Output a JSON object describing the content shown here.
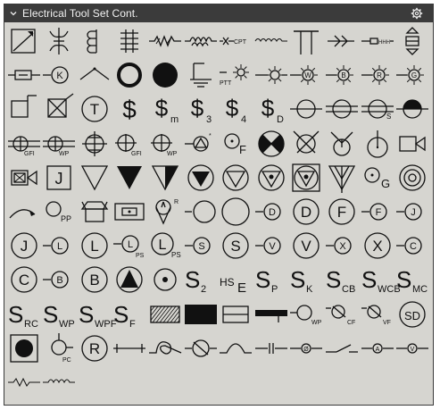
{
  "panel": {
    "title": "Electrical Tool Set Cont.",
    "collapse_icon": "chevron-down-icon",
    "settings_icon": "gear-icon"
  },
  "symbols": [
    {
      "row": 0,
      "col": 0,
      "kind": "box-diagonal"
    },
    {
      "row": 0,
      "col": 1,
      "kind": "transformer-fork"
    },
    {
      "row": 0,
      "col": 2,
      "kind": "coil-e"
    },
    {
      "row": 0,
      "col": 3,
      "kind": "coil-double"
    },
    {
      "row": 0,
      "col": 4,
      "kind": "zigzag-line"
    },
    {
      "row": 0,
      "col": 5,
      "kind": "coil-line"
    },
    {
      "row": 0,
      "col": 6,
      "kind": "cpt-line",
      "text": "CPT"
    },
    {
      "row": 0,
      "col": 7,
      "kind": "wave-line"
    },
    {
      "row": 0,
      "col": 8,
      "kind": "double-t"
    },
    {
      "row": 0,
      "col": 9,
      "kind": "arrows"
    },
    {
      "row": 0,
      "col": 10,
      "kind": "resistor-hhh",
      "text": "HHH"
    },
    {
      "row": 0,
      "col": 11,
      "kind": "updown-box"
    },
    {
      "row": 1,
      "col": 0,
      "kind": "fuse-line"
    },
    {
      "row": 1,
      "col": 1,
      "kind": "circle-letter-line",
      "text": "K"
    },
    {
      "row": 1,
      "col": 2,
      "kind": "switch-arc"
    },
    {
      "row": 1,
      "col": 3,
      "kind": "ring-bold"
    },
    {
      "row": 1,
      "col": 4,
      "kind": "dot-filled"
    },
    {
      "row": 1,
      "col": 5,
      "kind": "ground"
    },
    {
      "row": 1,
      "col": 6,
      "kind": "ptt-star",
      "text": "PTT"
    },
    {
      "row": 1,
      "col": 7,
      "kind": "star-line"
    },
    {
      "row": 1,
      "col": 8,
      "kind": "star-letter",
      "text": "W"
    },
    {
      "row": 1,
      "col": 9,
      "kind": "star-letter",
      "text": "B"
    },
    {
      "row": 1,
      "col": 10,
      "kind": "star-letter",
      "text": "R"
    },
    {
      "row": 1,
      "col": 11,
      "kind": "star-letter",
      "text": "G"
    },
    {
      "row": 2,
      "col": 0,
      "kind": "box-flag"
    },
    {
      "row": 2,
      "col": 1,
      "kind": "box-x-line"
    },
    {
      "row": 2,
      "col": 2,
      "kind": "circle-letter",
      "text": "T"
    },
    {
      "row": 2,
      "col": 3,
      "kind": "dollar",
      "text": "$"
    },
    {
      "row": 2,
      "col": 4,
      "kind": "dollar-sub",
      "text": "$",
      "sub": "m"
    },
    {
      "row": 2,
      "col": 5,
      "kind": "dollar-sub",
      "text": "$",
      "sub": "3"
    },
    {
      "row": 2,
      "col": 6,
      "kind": "dollar-sub",
      "text": "$",
      "sub": "4"
    },
    {
      "row": 2,
      "col": 7,
      "kind": "dollar-sub",
      "text": "$",
      "sub": "D"
    },
    {
      "row": 2,
      "col": 8,
      "kind": "circle-bar"
    },
    {
      "row": 2,
      "col": 9,
      "kind": "circle-double-bar"
    },
    {
      "row": 2,
      "col": 10,
      "kind": "circle-double-bar-sub",
      "text": "S"
    },
    {
      "row": 2,
      "col": 11,
      "kind": "circle-half"
    },
    {
      "row": 3,
      "col": 0,
      "kind": "circle-bars-sub",
      "text": "GFI"
    },
    {
      "row": 3,
      "col": 1,
      "kind": "circle-bars-sub",
      "text": "WP"
    },
    {
      "row": 3,
      "col": 2,
      "kind": "circle-cross"
    },
    {
      "row": 3,
      "col": 3,
      "kind": "circle-cross-sub",
      "text": "GFI"
    },
    {
      "row": 3,
      "col": 4,
      "kind": "circle-cross-sub",
      "text": "WP"
    },
    {
      "row": 3,
      "col": 5,
      "kind": "circle-triangle-star"
    },
    {
      "row": 3,
      "col": 6,
      "kind": "circle-dot-letter",
      "text": "F"
    },
    {
      "row": 3,
      "col": 7,
      "kind": "circle-x-quadrant"
    },
    {
      "row": 3,
      "col": 8,
      "kind": "circle-x-open"
    },
    {
      "row": 3,
      "col": 9,
      "kind": "circle-y"
    },
    {
      "row": 3,
      "col": 10,
      "kind": "circle-stem"
    },
    {
      "row": 3,
      "col": 11,
      "kind": "camera"
    },
    {
      "row": 4,
      "col": 0,
      "kind": "camera-x"
    },
    {
      "row": 4,
      "col": 1,
      "kind": "box-letter",
      "text": "J"
    },
    {
      "row": 4,
      "col": 2,
      "kind": "triangle-open"
    },
    {
      "row": 4,
      "col": 3,
      "kind": "triangle-filled"
    },
    {
      "row": 4,
      "col": 4,
      "kind": "triangle-half"
    },
    {
      "row": 4,
      "col": 5,
      "kind": "circle-tri-filled"
    },
    {
      "row": 4,
      "col": 6,
      "kind": "circle-tri-open"
    },
    {
      "row": 4,
      "col": 7,
      "kind": "circle-tri-dot"
    },
    {
      "row": 4,
      "col": 8,
      "kind": "box-circle-tri"
    },
    {
      "row": 4,
      "col": 9,
      "kind": "tri-stem"
    },
    {
      "row": 4,
      "col": 10,
      "kind": "circle-o-letter",
      "text": "G"
    },
    {
      "row": 4,
      "col": 11,
      "kind": "target"
    },
    {
      "row": 5,
      "col": 0,
      "kind": "arc-arrow"
    },
    {
      "row": 5,
      "col": 1,
      "kind": "circle-sub-small",
      "text": "PP"
    },
    {
      "row": 5,
      "col": 2,
      "kind": "box-tray"
    },
    {
      "row": 5,
      "col": 3,
      "kind": "box-oval"
    },
    {
      "row": 5,
      "col": 4,
      "kind": "antenna",
      "text": "R"
    },
    {
      "row": 5,
      "col": 5,
      "kind": "circle-line-left"
    },
    {
      "row": 5,
      "col": 6,
      "kind": "circle-plain"
    },
    {
      "row": 5,
      "col": 7,
      "kind": "circle-letter-line",
      "text": "D"
    },
    {
      "row": 5,
      "col": 8,
      "kind": "circle-letter",
      "text": "D"
    },
    {
      "row": 5,
      "col": 9,
      "kind": "circle-letter",
      "text": "F"
    },
    {
      "row": 5,
      "col": 10,
      "kind": "circle-letter-line",
      "text": "F"
    },
    {
      "row": 5,
      "col": 11,
      "kind": "circle-letter-line",
      "text": "J"
    },
    {
      "row": 6,
      "col": 0,
      "kind": "circle-letter",
      "text": "J"
    },
    {
      "row": 6,
      "col": 1,
      "kind": "circle-letter-line",
      "text": "L"
    },
    {
      "row": 6,
      "col": 2,
      "kind": "circle-letter",
      "text": "L"
    },
    {
      "row": 6,
      "col": 3,
      "kind": "circle-letter-line-sub",
      "text": "L",
      "sub": "PS"
    },
    {
      "row": 6,
      "col": 4,
      "kind": "circle-letter-sub",
      "text": "L",
      "sub": "PS"
    },
    {
      "row": 6,
      "col": 5,
      "kind": "circle-letter-line",
      "text": "S"
    },
    {
      "row": 6,
      "col": 6,
      "kind": "circle-letter",
      "text": "S"
    },
    {
      "row": 6,
      "col": 7,
      "kind": "circle-letter-line",
      "text": "V"
    },
    {
      "row": 6,
      "col": 8,
      "kind": "circle-letter",
      "text": "V"
    },
    {
      "row": 6,
      "col": 9,
      "kind": "circle-letter-line",
      "text": "X"
    },
    {
      "row": 6,
      "col": 10,
      "kind": "circle-letter",
      "text": "X"
    },
    {
      "row": 6,
      "col": 11,
      "kind": "circle-letter-line",
      "text": "C"
    },
    {
      "row": 7,
      "col": 0,
      "kind": "circle-letter",
      "text": "C"
    },
    {
      "row": 7,
      "col": 1,
      "kind": "circle-letter-line",
      "text": "B"
    },
    {
      "row": 7,
      "col": 2,
      "kind": "circle-letter",
      "text": "B"
    },
    {
      "row": 7,
      "col": 3,
      "kind": "circle-tri-up-filled"
    },
    {
      "row": 7,
      "col": 4,
      "kind": "circle-dot-small"
    },
    {
      "row": 7,
      "col": 5,
      "kind": "s-sub",
      "text": "S",
      "sub": "2"
    },
    {
      "row": 7,
      "col": 6,
      "kind": "hse",
      "text": "HS",
      "sub": "E"
    },
    {
      "row": 7,
      "col": 7,
      "kind": "s-sub",
      "text": "S",
      "sub": "P"
    },
    {
      "row": 7,
      "col": 8,
      "kind": "s-sub",
      "text": "S",
      "sub": "K"
    },
    {
      "row": 7,
      "col": 9,
      "kind": "s-sub",
      "text": "S",
      "sub": "CB"
    },
    {
      "row": 7,
      "col": 10,
      "kind": "s-sub",
      "text": "S",
      "sub": "WCB"
    },
    {
      "row": 7,
      "col": 11,
      "kind": "s-sub",
      "text": "S",
      "sub": "MC"
    },
    {
      "row": 8,
      "col": 0,
      "kind": "s-sub",
      "text": "S",
      "sub": "RC"
    },
    {
      "row": 8,
      "col": 1,
      "kind": "s-sub",
      "text": "S",
      "sub": "WP"
    },
    {
      "row": 8,
      "col": 2,
      "kind": "s-sub",
      "text": "S",
      "sub": "WPF"
    },
    {
      "row": 8,
      "col": 3,
      "kind": "s-sub",
      "text": "S",
      "sub": "F"
    },
    {
      "row": 8,
      "col": 4,
      "kind": "box-hatched"
    },
    {
      "row": 8,
      "col": 5,
      "kind": "box-black"
    },
    {
      "row": 8,
      "col": 6,
      "kind": "box-split-line"
    },
    {
      "row": 8,
      "col": 7,
      "kind": "bar-thick"
    },
    {
      "row": 8,
      "col": 8,
      "kind": "circle-line-sub",
      "text": "WP"
    },
    {
      "row": 8,
      "col": 9,
      "kind": "tilted-circle-sub",
      "text": "CF"
    },
    {
      "row": 8,
      "col": 10,
      "kind": "tilted-circle-sub",
      "text": "VF"
    },
    {
      "row": 8,
      "col": 11,
      "kind": "circle-letter",
      "text": "SD"
    },
    {
      "row": 9,
      "col": 0,
      "kind": "box-dot"
    },
    {
      "row": 9,
      "col": 1,
      "kind": "circle-stem-sub",
      "text": "PC"
    },
    {
      "row": 9,
      "col": 2,
      "kind": "circle-letter",
      "text": "R"
    },
    {
      "row": 9,
      "col": 3,
      "kind": "line-ticks"
    },
    {
      "row": 9,
      "col": 4,
      "kind": "loop-line"
    },
    {
      "row": 9,
      "col": 5,
      "kind": "tilted-circle-line"
    },
    {
      "row": 9,
      "col": 6,
      "kind": "arch-line"
    },
    {
      "row": 9,
      "col": 7,
      "kind": "break-line"
    },
    {
      "row": 9,
      "col": 8,
      "kind": "small-circle-line",
      "text": "Ø"
    },
    {
      "row": 9,
      "col": 9,
      "kind": "slant-switch"
    },
    {
      "row": 9,
      "col": 10,
      "kind": "small-circle-line",
      "text": "A"
    },
    {
      "row": 9,
      "col": 11,
      "kind": "small-circle-line",
      "text": "V"
    },
    {
      "row": 10,
      "col": 0,
      "kind": "zigzag-short"
    },
    {
      "row": 10,
      "col": 1,
      "kind": "coil-short"
    }
  ]
}
